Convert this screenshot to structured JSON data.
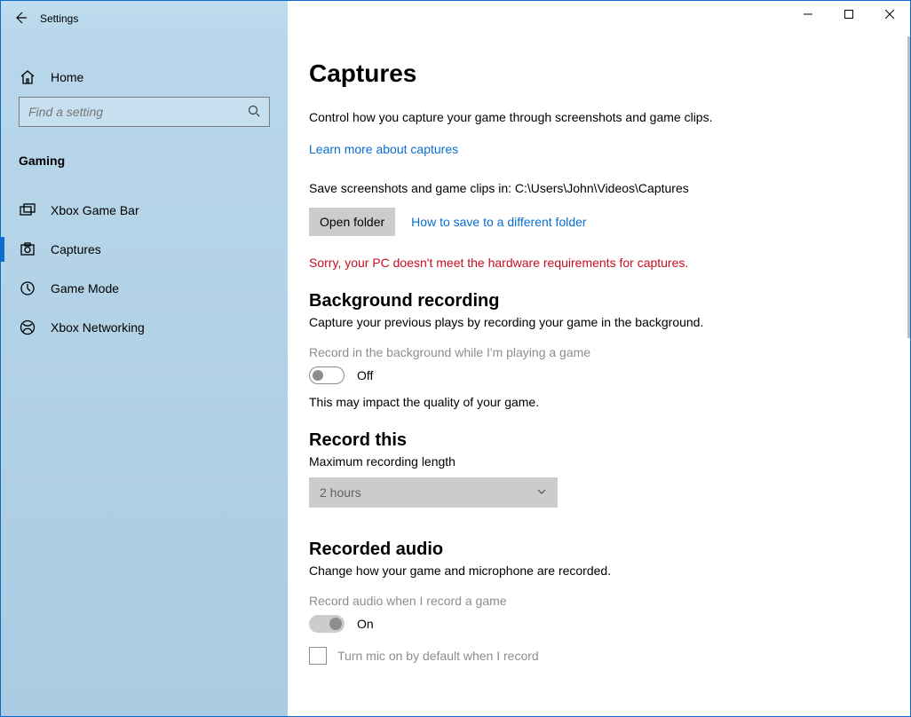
{
  "app_title": "Settings",
  "sidebar": {
    "home": "Home",
    "search_placeholder": "Find a setting",
    "section": "Gaming",
    "items": [
      {
        "label": "Xbox Game Bar"
      },
      {
        "label": "Captures"
      },
      {
        "label": "Game Mode"
      },
      {
        "label": "Xbox Networking"
      }
    ]
  },
  "page": {
    "title": "Captures",
    "intro": "Control how you capture your game through screenshots and game clips.",
    "learn_more": "Learn more about captures",
    "save_path_label": "Save screenshots and game clips in: C:\\Users\\John\\Videos\\Captures",
    "open_folder_btn": "Open folder",
    "how_save_link": "How to save to a different folder",
    "error": "Sorry, your PC doesn't meet the hardware requirements for captures.",
    "bg": {
      "heading": "Background recording",
      "sub": "Capture your previous plays by recording your game in the background.",
      "toggle_label": "Record in the background while I'm playing a game",
      "toggle_state": "Off",
      "note": "This may impact the quality of your game."
    },
    "record_this": {
      "heading": "Record this",
      "sub": "Maximum recording length",
      "value": "2 hours"
    },
    "audio": {
      "heading": "Recorded audio",
      "sub": "Change how your game and microphone are recorded.",
      "toggle_label": "Record audio when I record a game",
      "toggle_state": "On",
      "mic_checkbox": "Turn mic on by default when I record"
    }
  }
}
